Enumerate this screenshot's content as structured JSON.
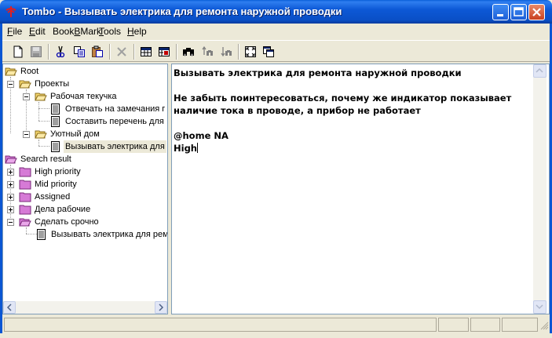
{
  "window": {
    "title": "Tombo - Вызывать электрика для ремонта наружной проводки",
    "colors": {
      "titlebar": "#0a5fd8",
      "close": "#c9411f",
      "folder": "#f5d76e",
      "search_folder": "#d67ad6"
    }
  },
  "menu": {
    "items": [
      {
        "accel": "F",
        "rest": "ile"
      },
      {
        "accel": "E",
        "rest": "dit"
      },
      {
        "accel": "B",
        "pre": "Book",
        "rest": "Mark"
      },
      {
        "accel": "T",
        "rest": "ools"
      },
      {
        "accel": "H",
        "rest": "elp"
      }
    ]
  },
  "toolbar": {
    "icons": [
      "new-icon",
      "save-icon",
      "cut-icon",
      "copy-icon",
      "paste-icon",
      "delete-icon",
      "table-icon",
      "table2-icon",
      "find-icon",
      "find-prev-icon",
      "find-next-icon",
      "fullscreen-icon",
      "two-pane-icon"
    ]
  },
  "tree": {
    "root": "Root",
    "projects": "Проекты",
    "work_in_progress": "Рабочая текучка",
    "note1": "Отвечать на замечания г",
    "note2": "Составить перечень для",
    "cozy_home": "Уютный дом",
    "note3": "Вызывать электрика для",
    "search_result": "Search result",
    "high_priority": "High priority",
    "mid_priority": "Mid priority",
    "assigned": "Assigned",
    "work_affairs": "Дела рабочие",
    "do_urgently": "Сделать срочно",
    "note4": "Вызывать электрика для рем"
  },
  "editor": {
    "line1": "Вызывать электрика для ремонта наружной проводки",
    "line2": "",
    "line3": "Не забыть поинтересоваться, почему же индикатор показывает",
    "line4": "наличие тока в проводе, а прибор не работает",
    "line5": "",
    "line6": "@home NA",
    "line7": "High"
  }
}
